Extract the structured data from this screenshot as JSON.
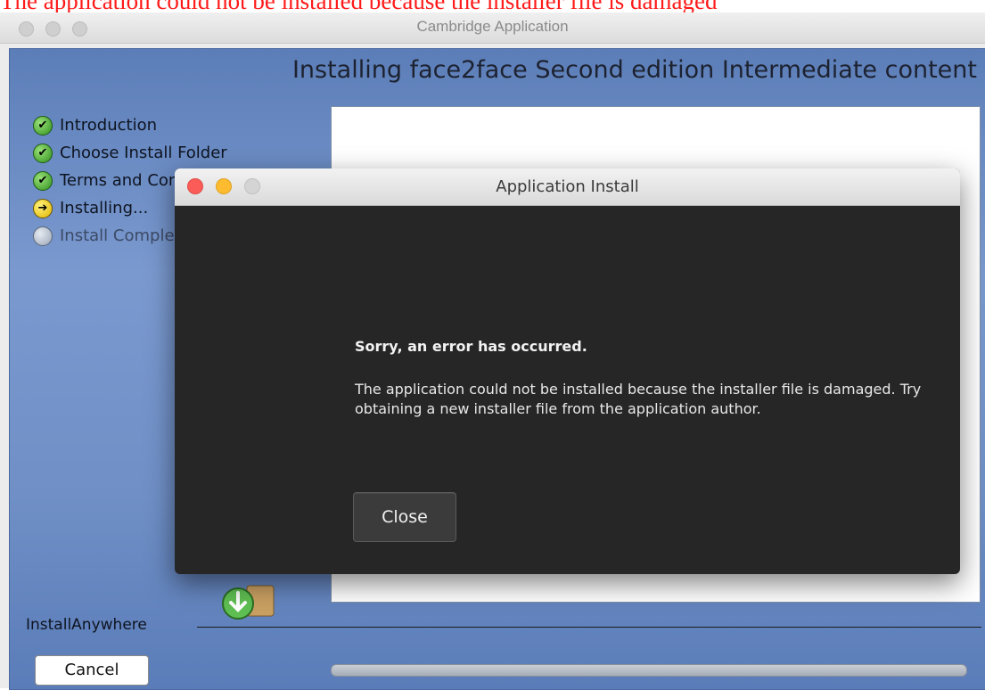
{
  "caption": "The application could not be installed because the installer file is damaged",
  "outer_window": {
    "title": "Cambridge Application"
  },
  "installer": {
    "heading": "Installing face2face Second edition Intermediate content",
    "steps": [
      {
        "label": "Introduction",
        "state": "done"
      },
      {
        "label": "Choose Install Folder",
        "state": "done"
      },
      {
        "label": "Terms and Conditions",
        "state": "done"
      },
      {
        "label": "Installing...",
        "state": "current"
      },
      {
        "label": "Install Complete",
        "state": "pending"
      }
    ],
    "brand": "InstallAnywhere",
    "cancel_label": "Cancel",
    "progress_fraction": 1.0
  },
  "dialog": {
    "title": "Application Install",
    "heading": "Sorry, an error has occurred.",
    "message": "The application could not be installed because the installer file is damaged. Try obtaining a new installer file from the application author.",
    "close_label": "Close"
  },
  "colors": {
    "caption": "#ff1a1a",
    "installer_bg": "#6f8fc6",
    "dialog_bg": "#262626",
    "light_red": "#fc5c57",
    "light_yellow": "#fdbc2f"
  }
}
